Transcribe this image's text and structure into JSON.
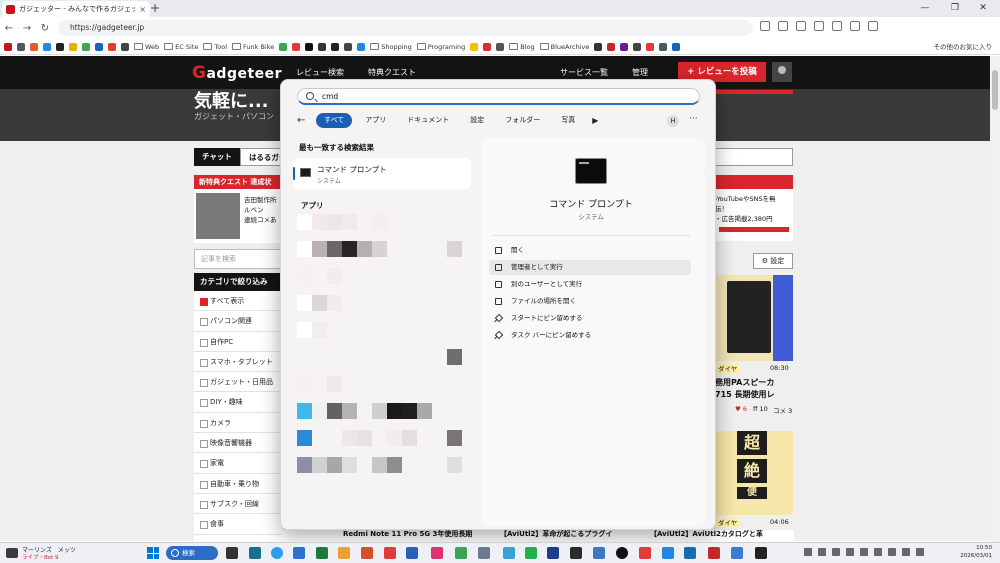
{
  "browser": {
    "tab_title": "ガジェッター - みんなで作るガジェットレビ",
    "close_glyph": "×",
    "new_tab_glyph": "+",
    "url": "https://gadgeteer.jp",
    "bookmarks": [
      "Web",
      "EC Site",
      "Tool",
      "Funk Bike",
      "Shopping",
      "Programing",
      "Blog",
      "BlueArchive"
    ],
    "bookmarks_more": "その他のお気に入り"
  },
  "site": {
    "logo_initial": "G",
    "logo_rest": "adgeteer",
    "nav": [
      "レビュー検索",
      "特典クエスト",
      "サービス一覧",
      "管理"
    ],
    "post_button": "+ レビューを投稿",
    "hero_title": "気軽に...",
    "hero_sub": "ガジェット・パソコン",
    "chat_tab": "チャット",
    "chat_tab2": "はるるガジ",
    "quest_header": "新特典クエスト 達成状",
    "quest_line1": "吉田製作所",
    "quest_line2": "ルベン",
    "quest_line3": "連続コメあ",
    "filter_placeholder": "記事を検索",
    "category_header": "カテゴリで絞り込み",
    "categories": [
      "すべて表示",
      "パソコン関連",
      "自作PC",
      "スマホ・タブレット",
      "ガジェット・日用品",
      "DIY・趣味",
      "カメラ",
      "映像音響機器",
      "家電",
      "自動車・乗り物",
      "サブスク・回線",
      "食事"
    ],
    "right_card_line1": "-YouTubeやSNSを無",
    "right_card_line2": "伝！",
    "right_card_line3": "・広告掲載2,380円",
    "settings_label": "設定",
    "badge1": "ダイヤ",
    "time1": "08:30",
    "product_title1": "務用PAスピーカ",
    "product_title2": "715 長期使用レ",
    "likes1": "6",
    "ff1": "10",
    "comments1": "3",
    "thumb2_kanji": [
      "超",
      "絶",
      "便",
      "利"
    ],
    "badge2": "ダイヤ",
    "time2": "04:06",
    "bottom_titles": [
      "Redmi Note 11 Pro 5G 3年使用長期",
      "【AviUtl2】革命が起こるプラグイ",
      "【AviUtl2】AviUtl2カタログと革"
    ]
  },
  "startmenu": {
    "query": "cmd",
    "filters": [
      "すべて",
      "アプリ",
      "ドキュメント",
      "設定",
      "フォルダー",
      "写真"
    ],
    "avatar_initial": "H",
    "best_match_header": "最も一致する検索結果",
    "best_match_name": "コマンド プロンプト",
    "best_match_type": "システム",
    "apps_header": "アプリ",
    "detail_name": "コマンド プロンプト",
    "detail_type": "システム",
    "actions": [
      "開く",
      "管理者として実行",
      "別のユーザーとして実行",
      "ファイルの場所を開く",
      "スタートにピン留めする",
      "タスク バーにピン留めする"
    ]
  },
  "taskbar": {
    "weather_line1": "マーリンズ　メッツ",
    "weather_line2": "ライブ・Bot 9",
    "search_label": "検索",
    "clock_time": "10:50",
    "clock_date": "2026/03/01"
  }
}
